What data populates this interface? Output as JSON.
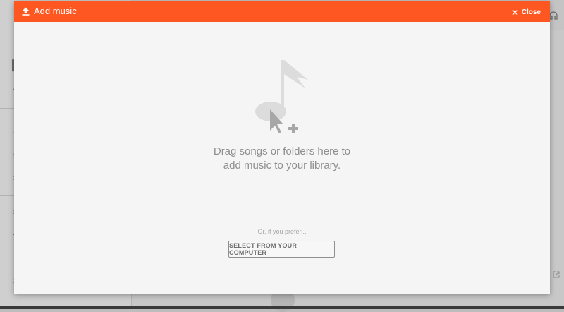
{
  "dialog": {
    "title": "Add music",
    "close_label": "Close",
    "drop_line_1": "Drag songs or folders here to",
    "drop_line_2": "add music to your library.",
    "prefer_text": "Or, if you prefer...",
    "select_button_label": "SELECT FROM YOUR COMPUTER"
  },
  "icons": {
    "header": "upload-icon",
    "close": "close-icon",
    "illustration": "music-note-cursor-plus-icon",
    "external_link": "open-in-new-icon"
  },
  "colors": {
    "header_accent": "#ff5722",
    "dialog_background": "#f5f5f5",
    "drop_text": "#8e8e8e",
    "button_border": "#8f8f8f"
  }
}
